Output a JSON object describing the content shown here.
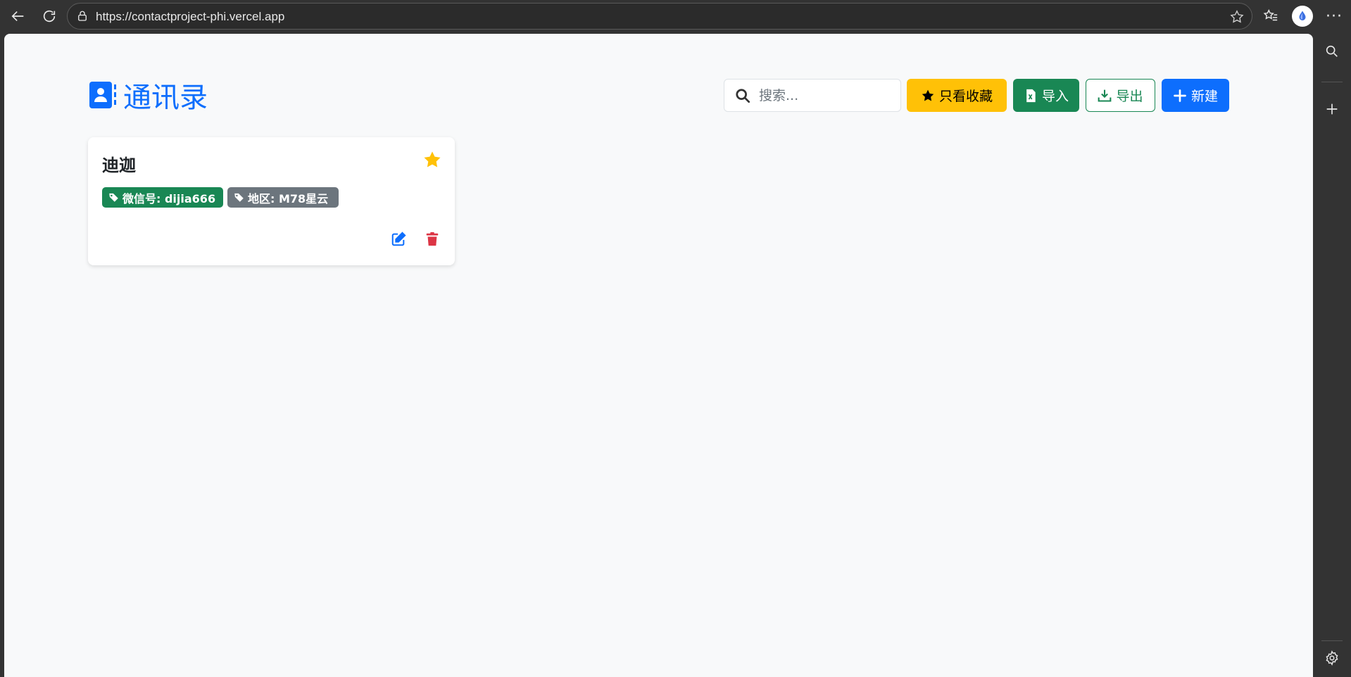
{
  "browser": {
    "url": "https://contactproject-phi.vercel.app"
  },
  "app": {
    "title": "通讯录",
    "colors": {
      "primary": "#0d6efd",
      "warning": "#ffc107",
      "success": "#198754",
      "secondary": "#6c757d",
      "danger": "#dc3545"
    }
  },
  "toolbar": {
    "search_placeholder": "搜索...",
    "favorites_label": "只看收藏",
    "import_label": "导入",
    "export_label": "导出",
    "new_label": "新建"
  },
  "contacts": [
    {
      "name": "迪迦",
      "favorite": true,
      "tags": [
        {
          "label": "微信号: dijia666",
          "color": "#198754"
        },
        {
          "label": "地区: M78星云",
          "color": "#6c757d"
        }
      ]
    }
  ]
}
